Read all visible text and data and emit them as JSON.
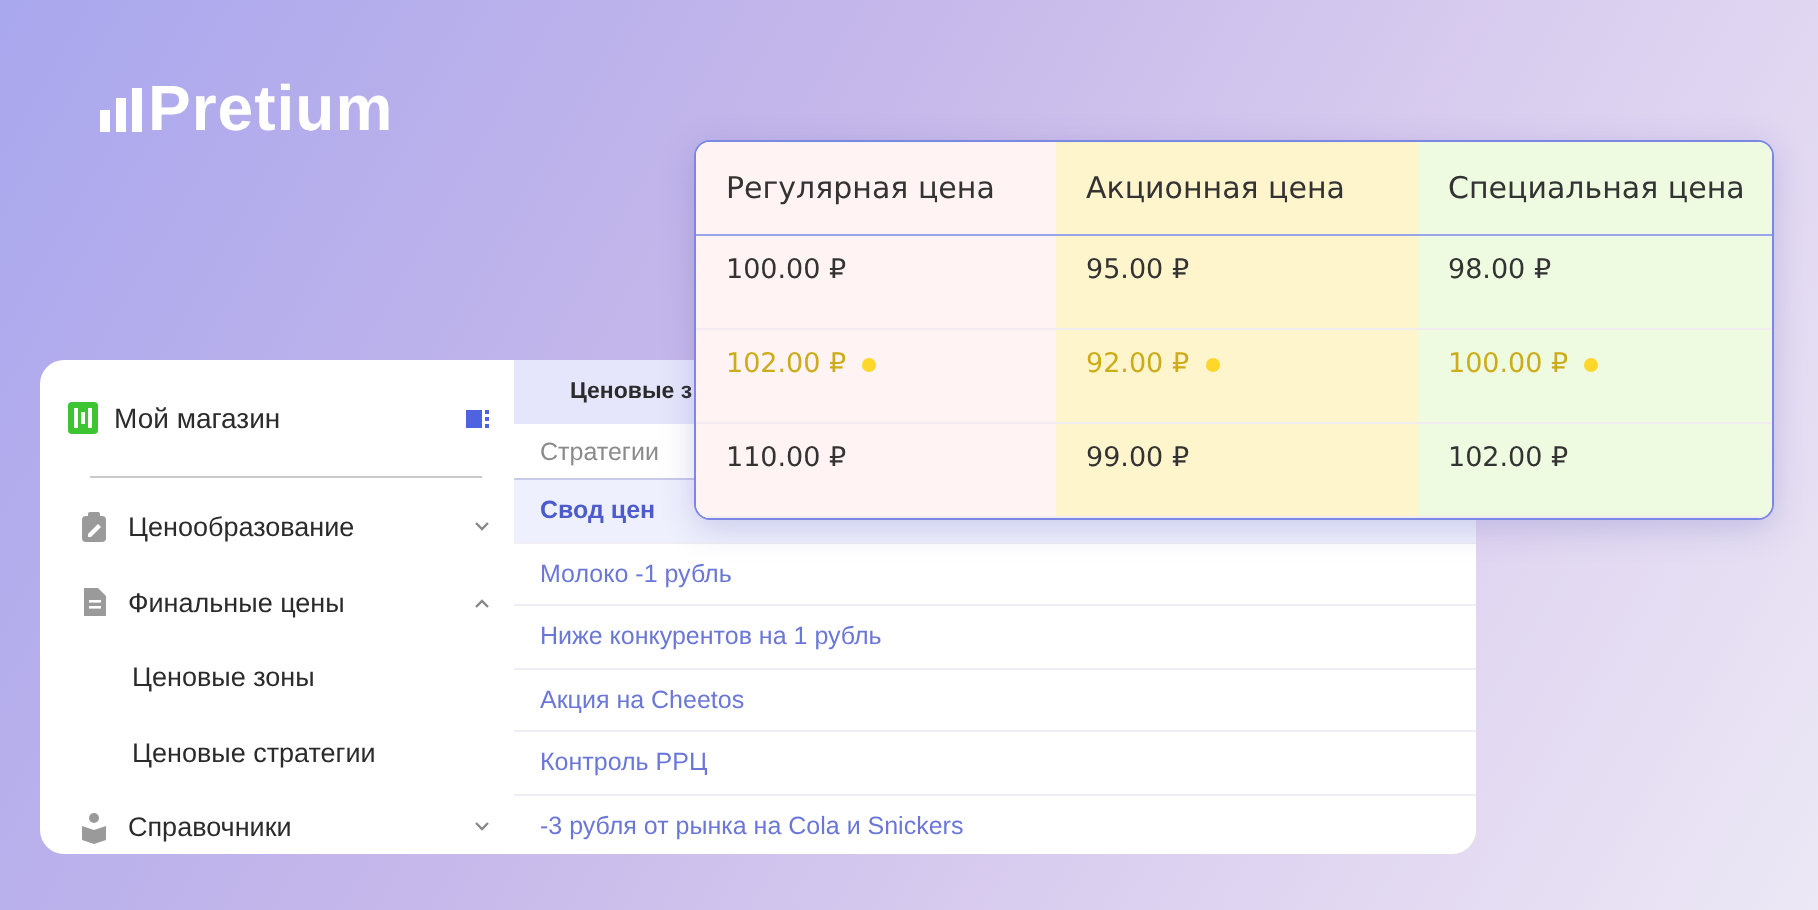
{
  "logo": {
    "text": "Pretium"
  },
  "sidebar": {
    "store": "Мой магазин",
    "items": [
      {
        "label": "Ценообразование",
        "kind": "pricing",
        "expanded": false
      },
      {
        "label": "Финальные цены",
        "kind": "document",
        "expanded": true,
        "children": [
          {
            "label": "Ценовые зоны"
          },
          {
            "label": "Ценовые стратегии"
          }
        ]
      },
      {
        "label": "Справочники",
        "kind": "reference",
        "expanded": false
      }
    ]
  },
  "strategy_panel": {
    "tab": "Ценовые з",
    "column": "Стратегии",
    "rows": [
      {
        "label": "Свод цен",
        "selected": true
      },
      {
        "label": "Молоко -1 рубль",
        "selected": false
      },
      {
        "label": "Ниже конкурентов на 1 рубль",
        "selected": false
      },
      {
        "label": "Акция на Cheetos",
        "selected": false
      },
      {
        "label": "Контроль РРЦ",
        "selected": false
      },
      {
        "label": "-3 рубля от рынка на Cola и Snickers",
        "selected": false
      }
    ]
  },
  "price_table": {
    "columns": [
      {
        "label": "Регулярная цена",
        "color": "#fff4f3"
      },
      {
        "label": "Акционная цена",
        "color": "#fff5cc"
      },
      {
        "label": "Специальная цена",
        "color": "#eefbe0"
      }
    ],
    "rows": [
      {
        "flagged": false,
        "cells": [
          "100.00  ₽",
          "95.00  ₽",
          "98.00  ₽"
        ]
      },
      {
        "flagged": true,
        "cells": [
          "102.00  ₽",
          "92.00  ₽",
          "100.00  ₽"
        ]
      },
      {
        "flagged": false,
        "cells": [
          "110.00  ₽",
          "99.00  ₽",
          "102.00  ₽"
        ]
      }
    ]
  }
}
